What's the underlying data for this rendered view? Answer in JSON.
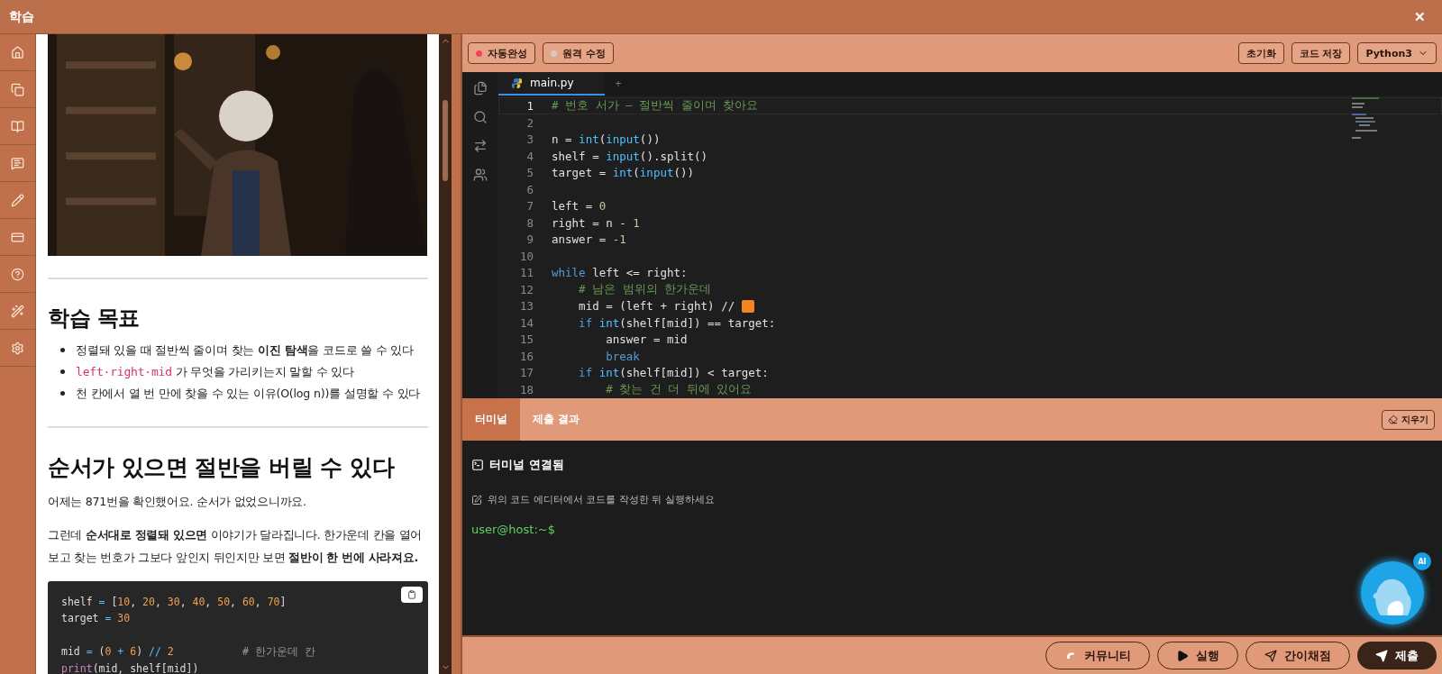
{
  "window": {
    "title": "학습",
    "close": "✕"
  },
  "lesson": {
    "picture": {
      "kind": "picture"
    },
    "objectives_heading": "학습 목표",
    "objectives": [
      {
        "text": "정렬돼 있을 때 절반씩 줄이며 찾는 **이진 탐색**을 코드로 쓸 수 있다"
      },
      {
        "code": "left·right·mid",
        "text": " 가 무엇을 가리키는지 말할 수 있다"
      },
      {
        "text": "천 칸에서 열 번 만에 찾을 수 있는 이유(O(log n))를 설명할 수 있다"
      }
    ],
    "section_heading": "순서가 있으면 절반을 버릴 수 있다",
    "paragraphs": [
      "어제는 871번을 확인했어요. 순서가 없었으니까요.",
      "그런데 **순서대로 정렬돼 있으면** 이야기가 달라집니다. 한가운데 칸을 열어 보고 찾는 번호가 그보다 앞인지 뒤인지만 보면 **절반이 한 번에 사라져요.**"
    ],
    "code_block": [
      {
        "kind": "code",
        "tokens": [
          {
            "kind": "plain",
            "text": "shelf "
          },
          {
            "kind": "op",
            "text": "= "
          },
          {
            "kind": "plain",
            "text": "["
          },
          {
            "kind": "num",
            "text": "10"
          },
          {
            "kind": "plain",
            "text": ", "
          },
          {
            "kind": "num",
            "text": "20"
          },
          {
            "kind": "plain",
            "text": ", "
          },
          {
            "kind": "num",
            "text": "30"
          },
          {
            "kind": "plain",
            "text": ", "
          },
          {
            "kind": "num",
            "text": "40"
          },
          {
            "kind": "plain",
            "text": ", "
          },
          {
            "kind": "num",
            "text": "50"
          },
          {
            "kind": "plain",
            "text": ", "
          },
          {
            "kind": "num",
            "text": "60"
          },
          {
            "kind": "plain",
            "text": ", "
          },
          {
            "kind": "num",
            "text": "70"
          },
          {
            "kind": "plain",
            "text": "]"
          }
        ]
      },
      {
        "kind": "code",
        "tokens": [
          {
            "kind": "plain",
            "text": "target "
          },
          {
            "kind": "op",
            "text": "= "
          },
          {
            "kind": "num",
            "text": "30"
          }
        ]
      },
      {
        "kind": "empty"
      },
      {
        "kind": "code",
        "tokens": [
          {
            "kind": "plain",
            "text": "mid "
          },
          {
            "kind": "op",
            "text": "= "
          },
          {
            "kind": "plain",
            "text": "("
          },
          {
            "kind": "num",
            "text": "0 "
          },
          {
            "kind": "op",
            "text": "+ "
          },
          {
            "kind": "num",
            "text": "6"
          },
          {
            "kind": "plain",
            "text": ") "
          },
          {
            "kind": "op",
            "text": "// "
          },
          {
            "kind": "num",
            "text": "2           "
          },
          {
            "kind": "comment",
            "text": "# 한가운데 칸"
          }
        ]
      },
      {
        "kind": "code",
        "tokens": [
          {
            "kind": "builtin",
            "text": "print"
          },
          {
            "kind": "plain",
            "text": "(mid, shelf[mid])"
          }
        ]
      }
    ]
  },
  "toolbar": {
    "toggles": [
      {
        "label": "자동완성",
        "on": true
      },
      {
        "label": "원격 수정",
        "on": false
      }
    ],
    "buttons": [
      "초기화",
      "코드 저장"
    ],
    "language": "Python3"
  },
  "editor": {
    "tabs": [
      {
        "label": "main.py",
        "selected": true
      }
    ],
    "new_tab": "+",
    "lines": [
      {
        "number": "1",
        "current": true,
        "tokens": [
          {
            "kind": "comment",
            "text": "# 번호 서가 — 절반씩 줄이며 찾아요"
          }
        ]
      },
      {
        "number": "2",
        "current": false
      },
      {
        "number": "3",
        "current": false,
        "tokens": [
          {
            "kind": "plain",
            "text": "n = "
          },
          {
            "kind": "builtin",
            "text": "int"
          },
          {
            "kind": "plain",
            "text": "("
          },
          {
            "kind": "builtin",
            "text": "input"
          },
          {
            "kind": "plain",
            "text": "())"
          }
        ]
      },
      {
        "number": "4",
        "current": false,
        "tokens": [
          {
            "kind": "plain",
            "text": "shelf = "
          },
          {
            "kind": "builtin",
            "text": "input"
          },
          {
            "kind": "plain",
            "text": "().split()"
          }
        ]
      },
      {
        "number": "5",
        "current": false,
        "tokens": [
          {
            "kind": "plain",
            "text": "target = "
          },
          {
            "kind": "builtin",
            "text": "int"
          },
          {
            "kind": "plain",
            "text": "("
          },
          {
            "kind": "builtin",
            "text": "input"
          },
          {
            "kind": "plain",
            "text": "())"
          }
        ]
      },
      {
        "number": "6",
        "current": false
      },
      {
        "number": "7",
        "current": false,
        "tokens": [
          {
            "kind": "plain",
            "text": "left = "
          },
          {
            "kind": "num",
            "text": "0"
          }
        ]
      },
      {
        "number": "8",
        "current": false,
        "tokens": [
          {
            "kind": "plain",
            "text": "right = n - "
          },
          {
            "kind": "num",
            "text": "1"
          }
        ]
      },
      {
        "number": "9",
        "current": false,
        "tokens": [
          {
            "kind": "plain",
            "text": "answer = "
          },
          {
            "kind": "num",
            "text": "-1"
          }
        ]
      },
      {
        "number": "10",
        "current": false
      },
      {
        "number": "11",
        "current": false,
        "tokens": [
          {
            "kind": "keyword",
            "text": "while "
          },
          {
            "kind": "plain",
            "text": "left <= right:"
          }
        ]
      },
      {
        "number": "12",
        "current": false,
        "tokens": [
          {
            "kind": "comment",
            "text": "    # 남은 범위의 한가운데"
          }
        ]
      },
      {
        "number": "13",
        "current": false,
        "tokens": [
          {
            "kind": "plain",
            "text": "    mid = (left + right) // "
          },
          {
            "kind": "blank"
          }
        ]
      },
      {
        "number": "14",
        "current": false,
        "tokens": [
          {
            "kind": "keyword",
            "text": "    if "
          },
          {
            "kind": "builtin",
            "text": "int"
          },
          {
            "kind": "plain",
            "text": "(shelf[mid]) == target:"
          }
        ]
      },
      {
        "number": "15",
        "current": false,
        "tokens": [
          {
            "kind": "plain",
            "text": "        answer = mid"
          }
        ]
      },
      {
        "number": "16",
        "current": false,
        "tokens": [
          {
            "kind": "keyword",
            "text": "        break"
          }
        ]
      },
      {
        "number": "17",
        "current": false,
        "tokens": [
          {
            "kind": "keyword",
            "text": "    if "
          },
          {
            "kind": "builtin",
            "text": "int"
          },
          {
            "kind": "plain",
            "text": "(shelf[mid]) < target:"
          }
        ]
      },
      {
        "number": "18",
        "current": false,
        "tokens": [
          {
            "kind": "comment",
            "text": "        # 찾는 건 더 뒤에 있어요"
          }
        ]
      }
    ]
  },
  "terminal": {
    "tabs": [
      {
        "label": "터미널",
        "selected": true
      },
      {
        "label": "제출 결과",
        "selected": false
      }
    ],
    "clear_button": "지우기",
    "status": "터미널 연결됨",
    "hint": "위의 코드 에디터에서 코드를 작성한 뒤 실행하세요",
    "prompt": "user@host:~$"
  },
  "assistant": {
    "badge": "AI"
  },
  "actions": [
    {
      "label": "커뮤니티",
      "primary": false
    },
    {
      "label": "실행",
      "primary": false
    },
    {
      "label": "간이채점",
      "primary": false
    },
    {
      "label": "제출",
      "primary": true
    }
  ]
}
